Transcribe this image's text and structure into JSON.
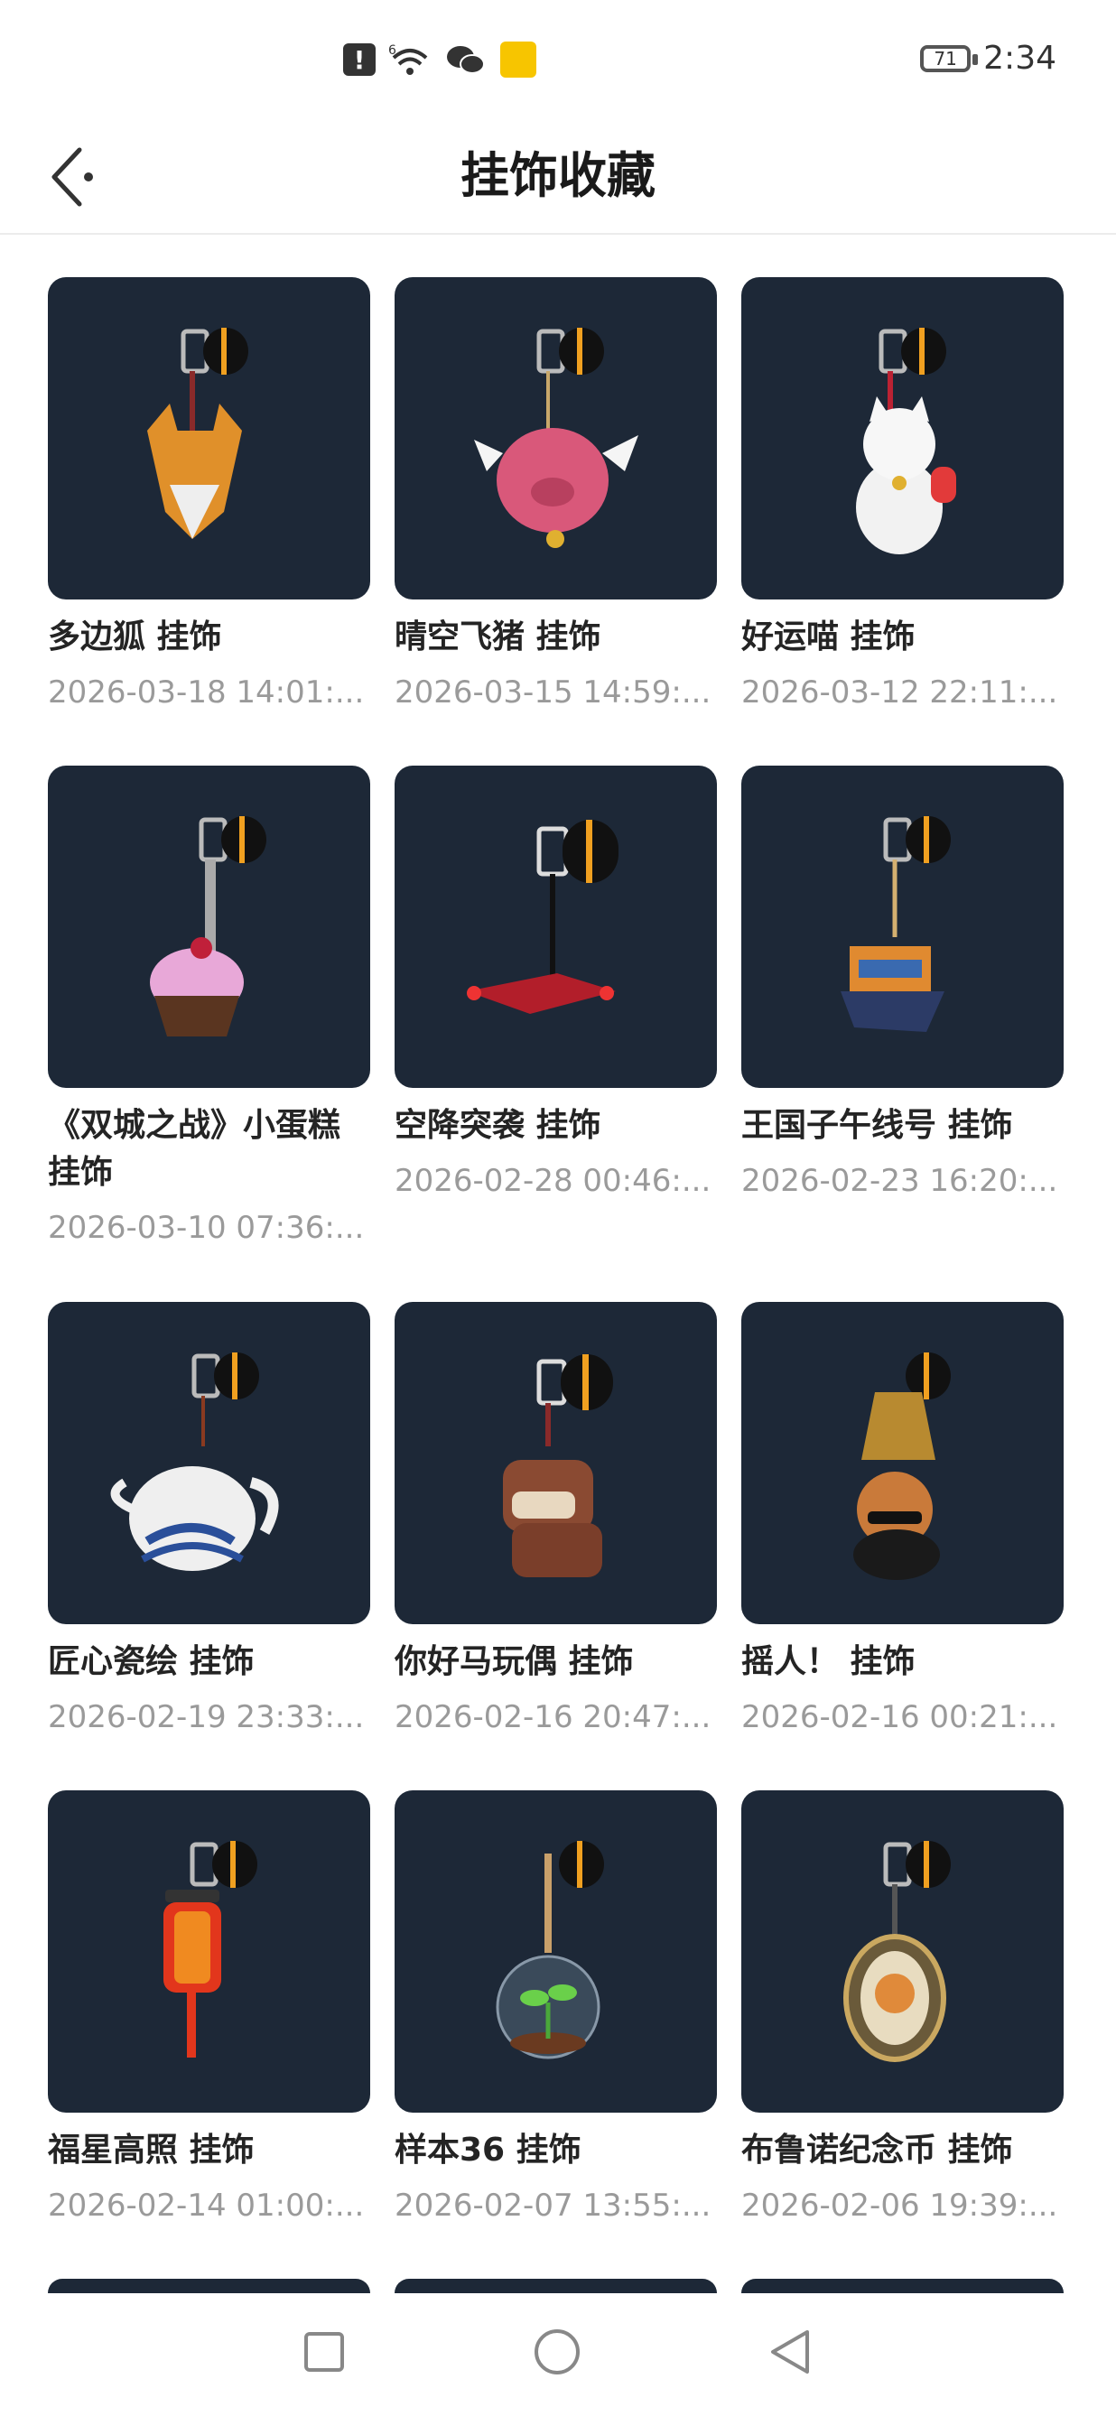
{
  "status_bar": {
    "alert_glyph": "!",
    "sim_label": "6",
    "battery": "71",
    "time": "2:34"
  },
  "header": {
    "title": "挂饰收藏"
  },
  "items": [
    {
      "name": "多边狐 挂饰",
      "date": "2026-03-18 14:01:..."
    },
    {
      "name": "晴空飞猪 挂饰",
      "date": "2026-03-15 14:59:..."
    },
    {
      "name": "好运喵 挂饰",
      "date": "2026-03-12 22:11:..."
    },
    {
      "name": "《双城之战》小蛋糕挂饰",
      "date": "2026-03-10 07:36:..."
    },
    {
      "name": "空降突袭 挂饰",
      "date": "2026-02-28 00:46:..."
    },
    {
      "name": "王国子午线号 挂饰",
      "date": "2026-02-23 16:20:..."
    },
    {
      "name": "匠心瓷绘 挂饰",
      "date": "2026-02-19 23:33:..."
    },
    {
      "name": "你好马玩偶 挂饰",
      "date": "2026-02-16 20:47:..."
    },
    {
      "name": "摇人！ 挂饰",
      "date": "2026-02-16 00:21:..."
    },
    {
      "name": "福星高照 挂饰",
      "date": "2026-02-14 01:00:..."
    },
    {
      "name": "样本36 挂饰",
      "date": "2026-02-07 13:55:..."
    },
    {
      "name": "布鲁诺纪念币 挂饰",
      "date": "2026-02-06 19:39:..."
    }
  ],
  "thumb_color": "#1d2837"
}
